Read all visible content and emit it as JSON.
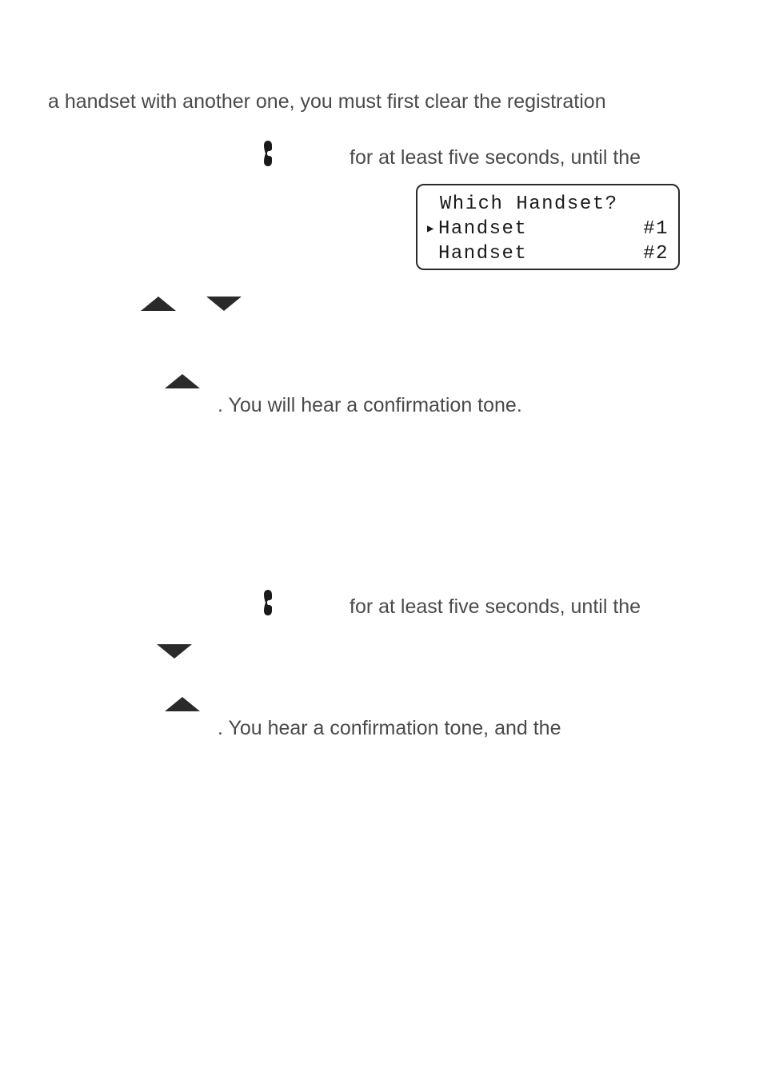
{
  "lines": {
    "l1": "a handset with another one, you must first clear the registration",
    "l2": "for at least five seconds, until the",
    "l3": ". You will hear a confirmation tone.",
    "l4": "for at least five seconds, until the",
    "l5": ". You hear a confirmation tone, and the"
  },
  "lcd": {
    "title": " Which Handset?",
    "row1": {
      "label": "Handset",
      "num": "#1",
      "selected": true
    },
    "row2": {
      "label": "Handset",
      "num": "#2",
      "selected": false
    }
  }
}
